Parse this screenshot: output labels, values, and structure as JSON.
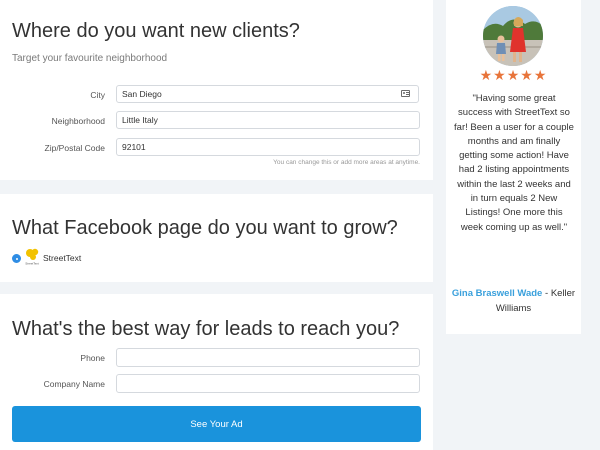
{
  "location": {
    "title": "Where do you want new clients?",
    "subtitle": "Target your favourite neighborhood",
    "fields": [
      {
        "label": "City",
        "value": "San Diego"
      },
      {
        "label": "Neighborhood",
        "value": "Little Italy"
      },
      {
        "label": "Zip/Postal Code",
        "value": "92101"
      }
    ],
    "hint": "You can change this or add more areas at anytime."
  },
  "facebook": {
    "title": "What Facebook page do you want to grow?",
    "page_name": "StreetText",
    "logo_caption": "StreetText"
  },
  "contact": {
    "title": "What's the best way for leads to reach you?",
    "fields": [
      {
        "label": "Phone",
        "value": ""
      },
      {
        "label": "Company Name",
        "value": ""
      }
    ],
    "button_label": "See Your Ad"
  },
  "testimonial": {
    "rating": 5,
    "stars": "★★★★★",
    "quote": "\"Having some great success with StreetText so far! Been a user for a couple months and am finally getting some action! Have had 2 listing appointments within the last 2 weeks and in turn equals 2 New Listings! One more this week coming up as well.\"",
    "author_name": "Gina Braswell Wade",
    "author_separator": " - ",
    "author_company": "Keller Williams"
  },
  "colors": {
    "accent": "#1a93dc",
    "star": "#e8743a",
    "author": "#3aa0dc",
    "background": "#f1f4f7"
  },
  "icons": [
    "contact-card-icon",
    "radio-selected-icon",
    "streettext-logo",
    "star-icon"
  ]
}
